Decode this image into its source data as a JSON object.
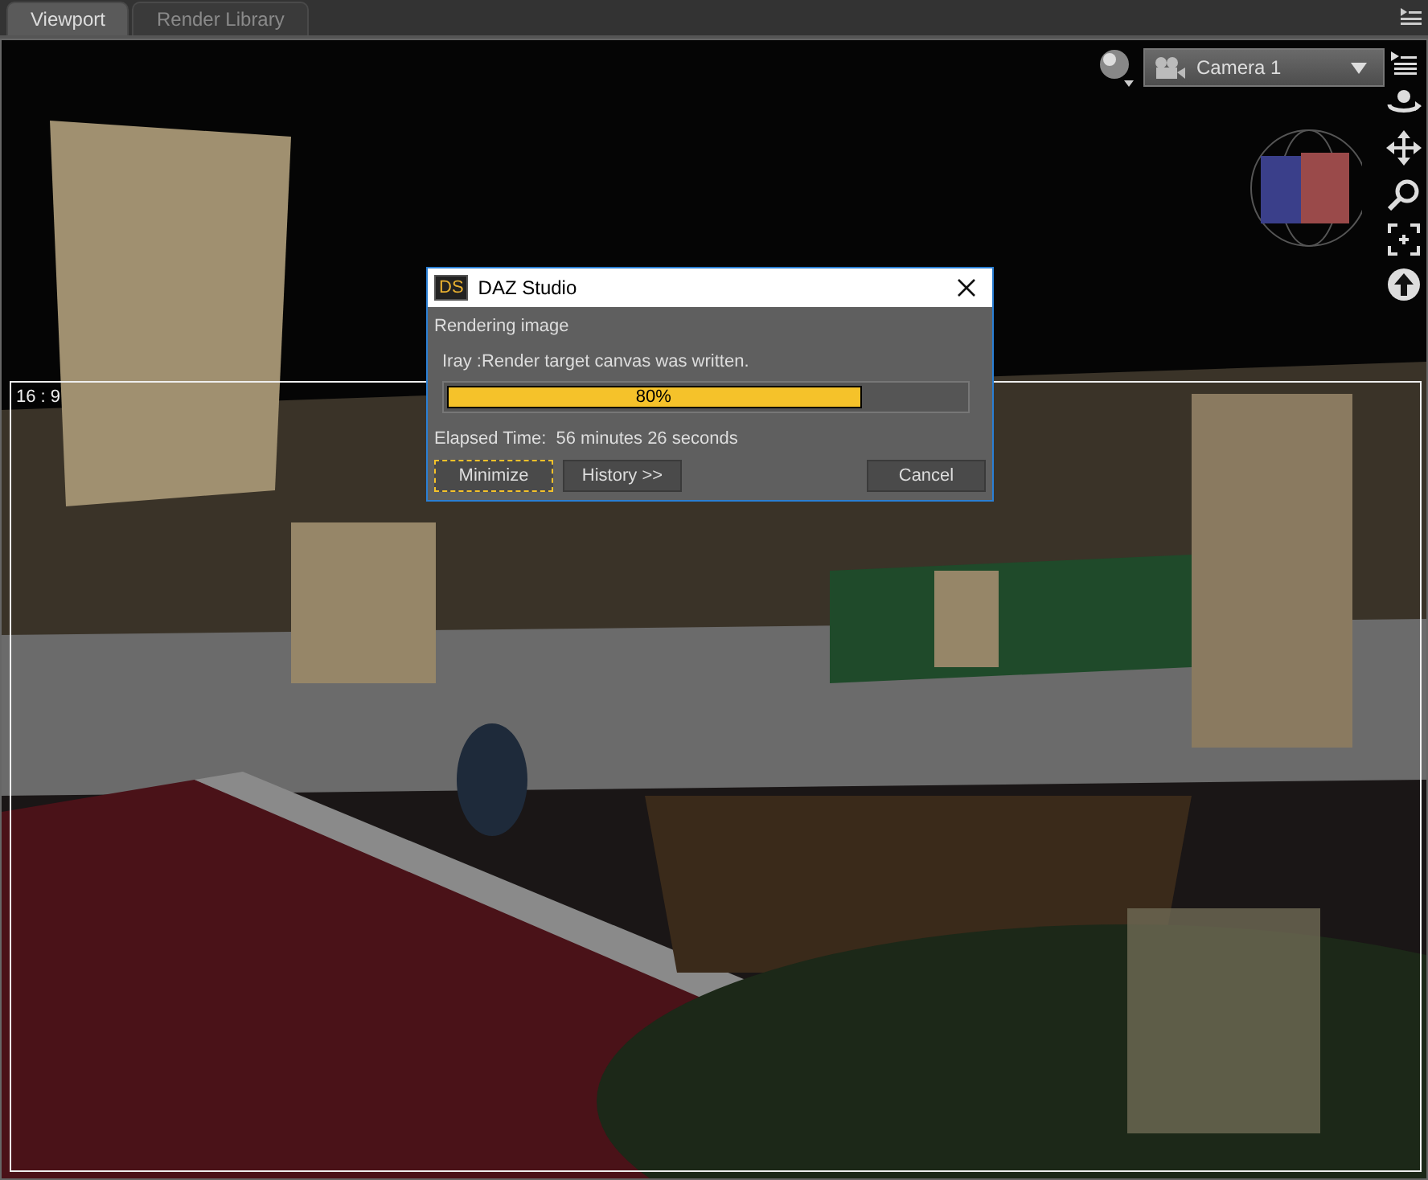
{
  "tabs": [
    {
      "label": "Viewport",
      "selected": true
    },
    {
      "label": "Render Library",
      "selected": false
    }
  ],
  "viewport": {
    "camera": "Camera 1",
    "aspect_label": "16 : 9"
  },
  "dialog": {
    "title": "DAZ Studio",
    "app_badge": "DS",
    "status": "Rendering image",
    "message": "Iray :Render target canvas was written.",
    "progress": {
      "level": 0.8,
      "label": "80%"
    },
    "elapsed_label": "Elapsed Time:",
    "elapsed_value": "56 minutes 26 seconds",
    "buttons": [
      {
        "label": "Minimize",
        "focused": true
      },
      {
        "label": "History >>",
        "focused": false
      },
      {
        "label": "Cancel",
        "focused": false
      }
    ]
  }
}
